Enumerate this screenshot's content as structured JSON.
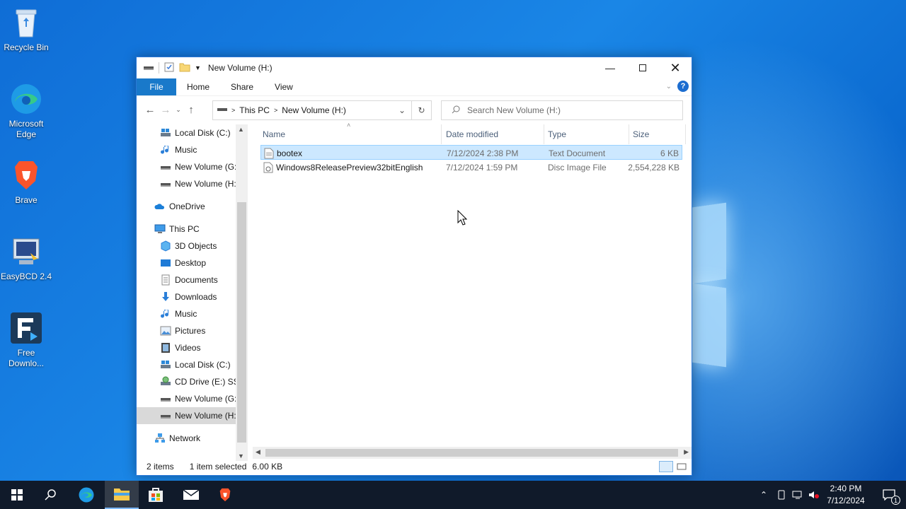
{
  "desktop": {
    "icons": [
      {
        "label": "Recycle Bin",
        "icon": "recycle-bin-icon"
      },
      {
        "label": "Microsoft Edge",
        "icon": "edge-icon"
      },
      {
        "label": "Brave",
        "icon": "brave-icon"
      },
      {
        "label": "EasyBCD 2.4",
        "icon": "easybcd-icon"
      },
      {
        "label": "Free Downlo...",
        "icon": "free-download-manager-icon"
      }
    ]
  },
  "window": {
    "title": "New Volume (H:)",
    "ribbon": {
      "file": "File",
      "tabs": [
        "Home",
        "Share",
        "View"
      ],
      "help": "?"
    },
    "address": {
      "segments": [
        "This PC",
        "New Volume (H:)"
      ],
      "separator": ">"
    },
    "search": {
      "placeholder": "Search New Volume (H:)"
    },
    "nav_pane": [
      {
        "label": "Local Disk (C:)",
        "icon": "local-disk-icon",
        "indent": 1
      },
      {
        "label": "Music",
        "icon": "music-icon",
        "indent": 1
      },
      {
        "label": "New Volume (G:",
        "icon": "drive-icon",
        "indent": 1
      },
      {
        "label": "New Volume (H:",
        "icon": "drive-icon",
        "indent": 1
      },
      {
        "label": "OneDrive",
        "icon": "onedrive-icon",
        "indent": 0,
        "gap": true
      },
      {
        "label": "This PC",
        "icon": "this-pc-icon",
        "indent": 0,
        "gap": true
      },
      {
        "label": "3D Objects",
        "icon": "3d-objects-icon",
        "indent": 1
      },
      {
        "label": "Desktop",
        "icon": "desktop-icon",
        "indent": 1
      },
      {
        "label": "Documents",
        "icon": "documents-icon",
        "indent": 1
      },
      {
        "label": "Downloads",
        "icon": "downloads-icon",
        "indent": 1
      },
      {
        "label": "Music",
        "icon": "music-icon",
        "indent": 1
      },
      {
        "label": "Pictures",
        "icon": "pictures-icon",
        "indent": 1
      },
      {
        "label": "Videos",
        "icon": "videos-icon",
        "indent": 1
      },
      {
        "label": "Local Disk (C:)",
        "icon": "local-disk-icon",
        "indent": 1
      },
      {
        "label": "CD Drive (E:) SSS",
        "icon": "cd-drive-icon",
        "indent": 1
      },
      {
        "label": "New Volume (G:",
        "icon": "drive-icon",
        "indent": 1
      },
      {
        "label": "New Volume (H:",
        "icon": "drive-icon",
        "indent": 1,
        "selected": true
      },
      {
        "label": "Network",
        "icon": "network-icon",
        "indent": 0,
        "gap": true
      }
    ],
    "columns": [
      "Name",
      "Date modified",
      "Type",
      "Size"
    ],
    "files": [
      {
        "name": "bootex",
        "date": "7/12/2024 2:38 PM",
        "type": "Text Document",
        "size": "6 KB",
        "selected": true,
        "icon": "text-file-icon"
      },
      {
        "name": "Windows8ReleasePreview32bitEnglish",
        "date": "7/12/2024 1:59 PM",
        "type": "Disc Image File",
        "size": "2,554,228 KB",
        "selected": false,
        "icon": "disc-image-icon"
      }
    ],
    "status": {
      "items": "2 items",
      "selected": "1 item selected",
      "size": "6.00 KB"
    }
  },
  "taskbar": {
    "time": "2:40 PM",
    "date": "7/12/2024",
    "notification_count": "1"
  }
}
